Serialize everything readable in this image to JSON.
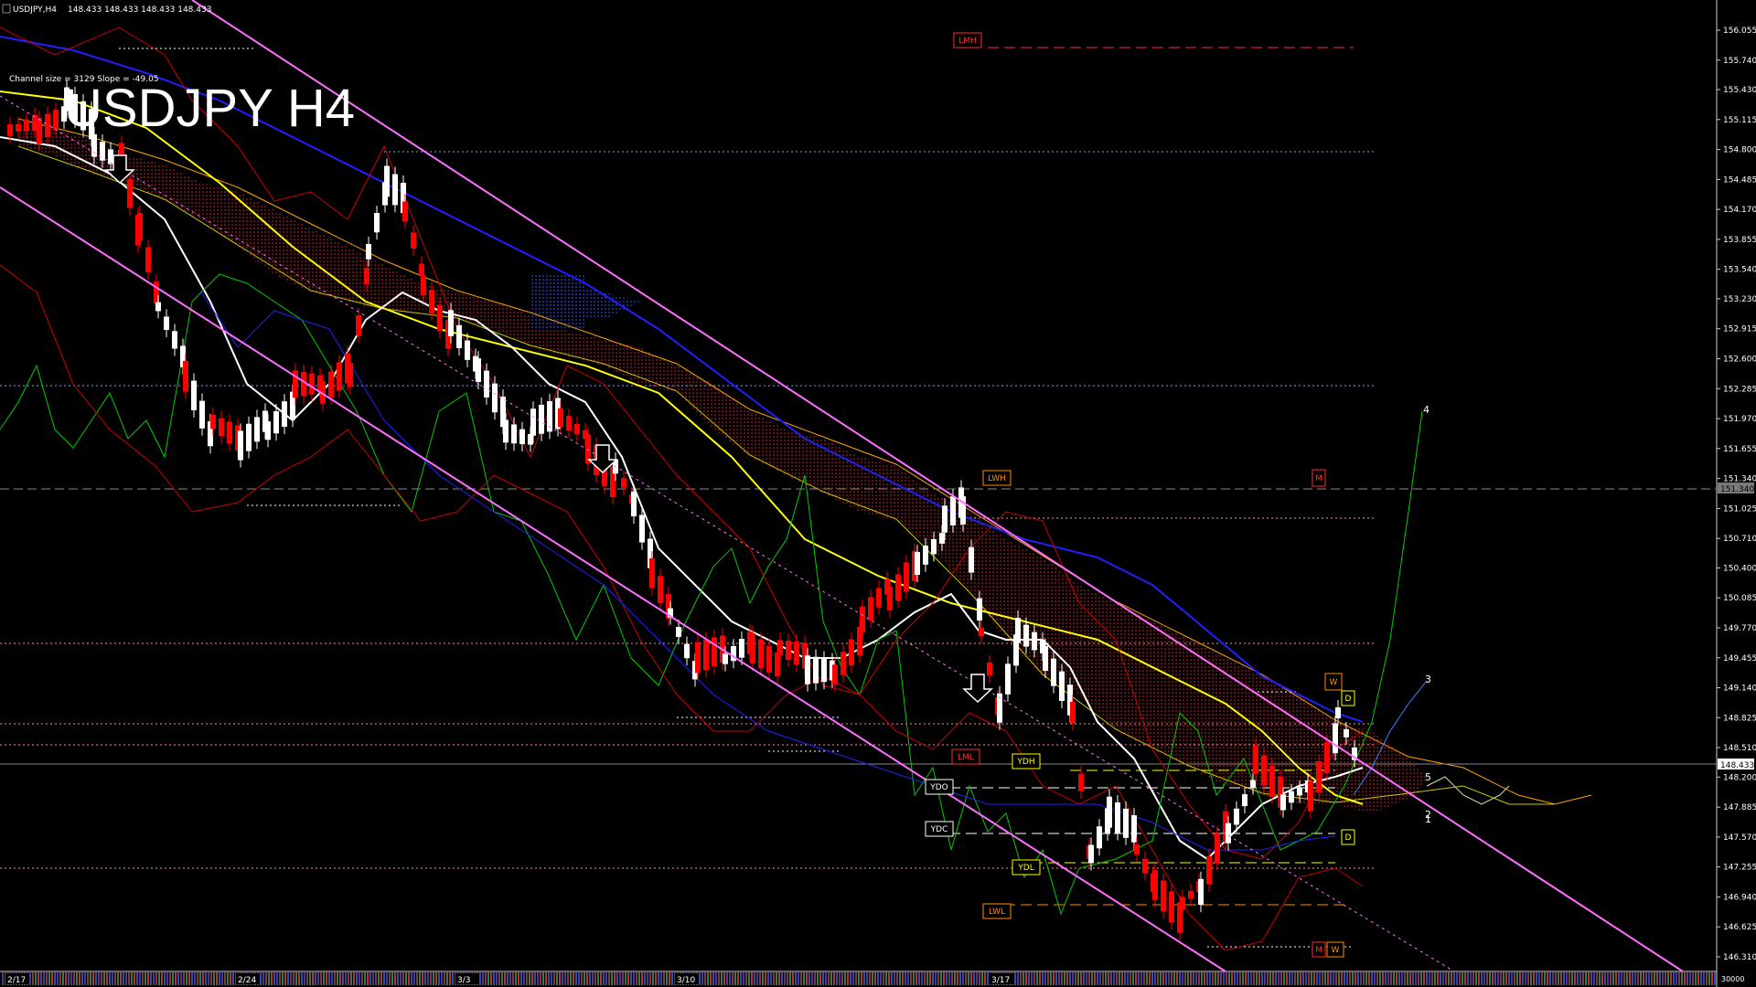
{
  "header": {
    "symbol_text": "USDJPY,H4",
    "quote_text": "148.433 148.433 148.433 148.433"
  },
  "chart_data": {
    "type": "candlestick",
    "title": "USDJPY H4",
    "channel_text": "Channel size = 3129 Slope = -49.05",
    "current_price_label": "148.433",
    "h_line_label": "151.340",
    "y_axis": {
      "ylim": [
        146.16,
        156.29
      ],
      "ticks": [
        "156.055",
        "155.740",
        "155.430",
        "155.115",
        "154.800",
        "154.485",
        "154.170",
        "153.855",
        "153.540",
        "153.230",
        "152.915",
        "152.600",
        "152.285",
        "151.970",
        "151.655",
        "151.340",
        "151.025",
        "150.710",
        "150.400",
        "150.085",
        "149.770",
        "149.455",
        "149.140",
        "148.825",
        "148.510",
        "148.200",
        "147.885",
        "147.570",
        "147.255",
        "146.940",
        "146.625",
        "146.310"
      ]
    },
    "x_axis": {
      "labels": [
        "2/17",
        "2/24",
        "3/3",
        "3/10",
        "3/17"
      ]
    },
    "subwindow_label": "30000",
    "levels": [
      {
        "label": "LMH",
        "color": "#ff2a2a"
      },
      {
        "label": "LWH",
        "color": "#ff8c00"
      },
      {
        "label": "M",
        "color": "#ff2a2a"
      },
      {
        "label": "LML",
        "color": "#ff2a2a"
      },
      {
        "label": "YDH",
        "color": "#ffff00"
      },
      {
        "label": "YDO",
        "color": "#ffffff"
      },
      {
        "label": "YDC",
        "color": "#ffffff"
      },
      {
        "label": "YDL",
        "color": "#ffff00"
      },
      {
        "label": "LWL",
        "color": "#ff8c00"
      },
      {
        "label": "W",
        "color": "#ff8c00"
      },
      {
        "label": "D",
        "color": "#ffff00"
      },
      {
        "label": "D",
        "color": "#ffff00"
      },
      {
        "label": "M",
        "color": "#ff2a2a"
      },
      {
        "label": "W",
        "color": "#ff8c00"
      }
    ],
    "wave_labels": [
      "4",
      "3",
      "5",
      "2",
      "1"
    ],
    "colors": {
      "bull": "#ffffff",
      "bear": "#ff0000",
      "channel": "#ff6fff",
      "ma_blue": "#2020ff",
      "ma_yellow": "#ffff00",
      "ma_white": "#ffffff",
      "green_line": "#00cc00",
      "cloud": "#ffa500",
      "bands": "#cc0000"
    }
  }
}
